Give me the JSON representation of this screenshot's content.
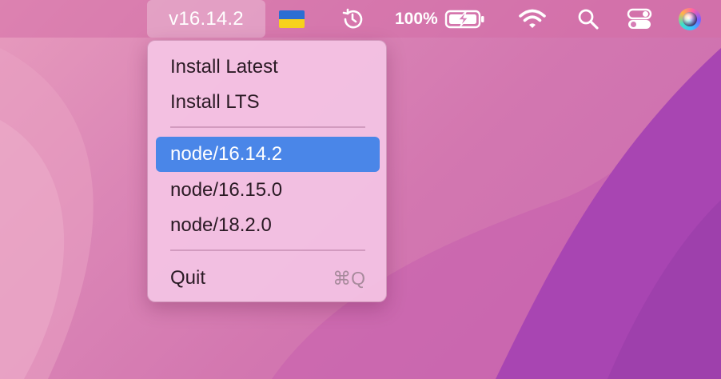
{
  "menubar": {
    "node_version": "v16.14.2",
    "flag": {
      "icon": "ukraine-flag-icon",
      "colors": [
        "#2b6ed3",
        "#f7d21c"
      ]
    },
    "time_machine_icon": "clock-history-icon",
    "battery": {
      "percent_text": "100%",
      "icon": "battery-charging-icon",
      "level": 1.0
    },
    "wifi_icon": "wifi-icon",
    "search_icon": "search-icon",
    "control_center_icon": "control-center-icon",
    "siri_icon": "siri-icon"
  },
  "menu": {
    "actions": [
      {
        "label": "Install Latest"
      },
      {
        "label": "Install LTS"
      }
    ],
    "versions": [
      {
        "label": "node/16.14.2",
        "selected": true
      },
      {
        "label": "node/16.15.0",
        "selected": false
      },
      {
        "label": "node/18.2.0",
        "selected": false
      }
    ],
    "quit": {
      "label": "Quit",
      "shortcut": "⌘Q"
    }
  },
  "colors": {
    "selection": "#4a86e8",
    "wallpaper_pink": "#d377b0",
    "wallpaper_purple": "#a845b2"
  }
}
